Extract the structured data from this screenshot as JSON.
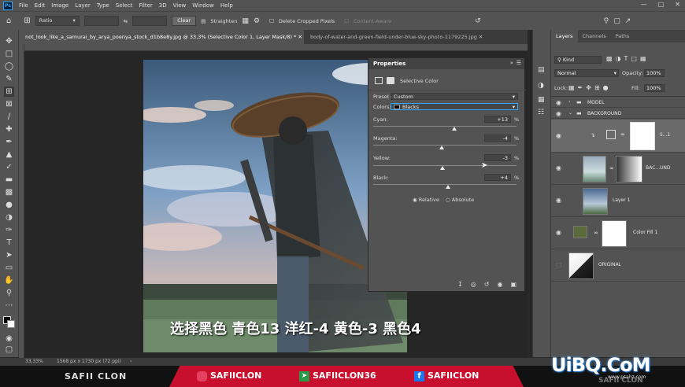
{
  "menu": [
    "File",
    "Edit",
    "Image",
    "Layer",
    "Type",
    "Select",
    "Filter",
    "3D",
    "View",
    "Window",
    "Help"
  ],
  "options": {
    "ratio": "Ratio",
    "clear": "Clear",
    "straighten": "Straighten",
    "delete_cropped": "Delete Cropped Pixels",
    "content_aware": "Content-Aware"
  },
  "tabs": [
    "not_look_like_a_samurai_by_arya_poenya_stock_d1b8e8y.jpg @ 33,3% (Selective Color 1, Layer Mask/8) *",
    "body-of-water-and-green-field-under-blue-sky-photo-1179225.jpg"
  ],
  "properties": {
    "title": "Properties",
    "type": "Selective Color",
    "preset_label": "Preset:",
    "preset_value": "Custom",
    "colors_label": "Colors:",
    "colors_value": "Blacks",
    "sliders": [
      {
        "label": "Cyan:",
        "value": "+13",
        "fraction": 0.565
      },
      {
        "label": "Magenta:",
        "value": "-4",
        "fraction": 0.48
      },
      {
        "label": "Yellow:",
        "value": "-3",
        "fraction": 0.485
      },
      {
        "label": "Black:",
        "value": "+4",
        "fraction": 0.52
      }
    ],
    "method_relative": "Relative",
    "method_absolute": "Absolute",
    "unit": "%"
  },
  "layers_panel": {
    "tabs": [
      "Layers",
      "Channels",
      "Paths"
    ],
    "kind": "Kind",
    "blend": "Normal",
    "opacity_label": "Opacity:",
    "opacity": "100%",
    "lock_label": "Lock:",
    "fill_label": "Fill:",
    "fill": "100%",
    "layers": [
      {
        "name": "MODEL",
        "type": "group"
      },
      {
        "name": "BACKGROUND",
        "type": "group"
      },
      {
        "name": "S...1",
        "type": "adjustment"
      },
      {
        "name": "BAC...UND",
        "type": "image"
      },
      {
        "name": "Layer 1",
        "type": "image"
      },
      {
        "name": "Color Fill 1",
        "type": "fill"
      },
      {
        "name": "ORIGINAL",
        "type": "image"
      }
    ]
  },
  "status": {
    "zoom": "33,33%",
    "doc_size": "1568 px x 1730 px (72 ppi)"
  },
  "subtitle": "选择黑色 青色13 洋红-4 黄色-3 黑色4",
  "banner": {
    "left": "SAFII CLON",
    "instagram": "SAFIICLON",
    "mid": "SAFIICLON36",
    "facebook": "SAFIICLON",
    "watermark": "UiBQ.CoM",
    "watermark_small": "www.psahz.com",
    "right_faded": "SAFII CLON"
  },
  "colors": {
    "accent": "#31a8ff",
    "banner_red": "#c8102e"
  }
}
